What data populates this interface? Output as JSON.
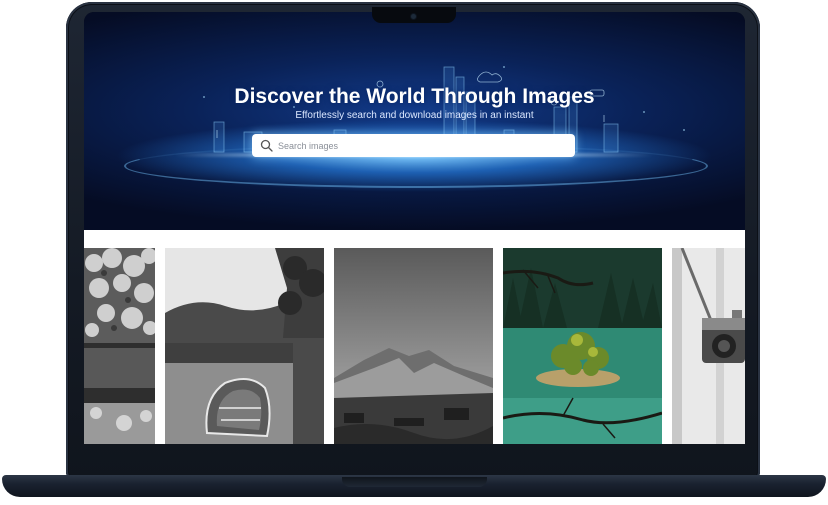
{
  "hero": {
    "title": "Discover the World Through Images",
    "subtitle": "Effortlessly search and download images in an instant"
  },
  "search": {
    "placeholder": "Search images",
    "value": "",
    "icon": "search-icon"
  },
  "gallery": {
    "items": [
      {
        "name": "forest-lake-photo",
        "style": "black-and-white"
      },
      {
        "name": "rowboat-lake-photo",
        "style": "black-and-white"
      },
      {
        "name": "mountain-range-photo",
        "style": "black-and-white"
      },
      {
        "name": "island-lake-photo",
        "style": "color"
      },
      {
        "name": "camera-on-stand-photo",
        "style": "black-and-white"
      }
    ]
  },
  "colors": {
    "hero_dark": "#050c24",
    "hero_glow": "#78c8ff",
    "laptop": "#1a2230"
  }
}
